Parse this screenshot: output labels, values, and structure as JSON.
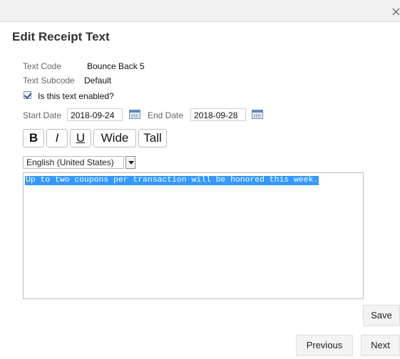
{
  "dialog": {
    "close_glyph": "×",
    "title": "Edit Receipt Text"
  },
  "fields": {
    "text_code_label": "Text Code",
    "text_code_value": "Bounce Back 5",
    "text_subcode_label": "Text Subcode",
    "text_subcode_value": "Default",
    "enabled_label": "Is this text enabled?",
    "enabled_checked": true,
    "start_date_label": "Start Date",
    "start_date_value": "2018-09-24",
    "end_date_label": "End Date",
    "end_date_value": "2018-09-28"
  },
  "format_toolbar": {
    "bold": "B",
    "italic": "I",
    "underline": "U",
    "wide": "Wide",
    "tall": "Tall"
  },
  "language_select": {
    "selected": "English (United States)"
  },
  "editor": {
    "text": "Up to two coupons per transaction will be honored this week.",
    "selection_color": "#3399ff"
  },
  "actions": {
    "save": "Save",
    "previous": "Previous",
    "next": "Next"
  },
  "icons": {
    "calendar": "calendar-icon",
    "dropdown": "chevron-down-icon",
    "close": "close-icon",
    "check": "check-icon"
  }
}
